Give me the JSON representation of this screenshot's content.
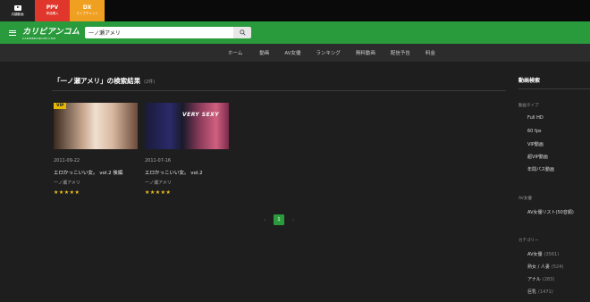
{
  "top_tabs": [
    {
      "label": "月額動画",
      "big": ""
    },
    {
      "label": "単品購入",
      "big": "PPV"
    },
    {
      "label": "ライブチャット",
      "big": "DX"
    }
  ],
  "logo": {
    "main": "カリビアンコム",
    "sub": "CARIBBEANCOM.COM"
  },
  "search": {
    "value": "一ノ瀬アメリ"
  },
  "nav": [
    "ホーム",
    "動画",
    "AV女優",
    "ランキング",
    "無料動画",
    "配信予告",
    "料金"
  ],
  "results": {
    "title": "「一ノ瀬アメリ」の検索結果",
    "count": "(2件)"
  },
  "cards": [
    {
      "badge": "VIP",
      "overlay": "",
      "date": "2011-09-22",
      "title": "エロかっこいい女。 vol.2 後編",
      "actress": "一ノ瀬アメリ",
      "stars": "★★★★★"
    },
    {
      "badge": "",
      "overlay": "VERY SEXY",
      "date": "2011-07-16",
      "title": "エロかっこいい女。 vol.2",
      "actress": "一ノ瀬アメリ",
      "stars": "★★★★★"
    }
  ],
  "pagination": {
    "prev": "‹",
    "current": "1",
    "next": "›"
  },
  "sidebar": {
    "title": "動画検索",
    "type_heading": "動画タイプ",
    "types": [
      "Full HD",
      "60 fps",
      "VIP動画",
      "超VIP動画",
      "年間パス動画"
    ],
    "av_heading": "AV女優",
    "av_items": [
      {
        "label": "AV女優リスト",
        "count": "(50音順)"
      }
    ],
    "cat_heading": "カテゴリー",
    "categories": [
      {
        "label": "AV女優",
        "count": "(3561)"
      },
      {
        "label": "熟女 / 人妻",
        "count": "(524)"
      },
      {
        "label": "アナル",
        "count": "(283)"
      },
      {
        "label": "巨乳",
        "count": "(1471)"
      }
    ]
  },
  "colors": {
    "green": "#2a9b3c",
    "ppv_red": "#e0362c",
    "dx_orange": "#f0a020",
    "vip_gold": "#e6b800",
    "star": "#f0c020"
  }
}
